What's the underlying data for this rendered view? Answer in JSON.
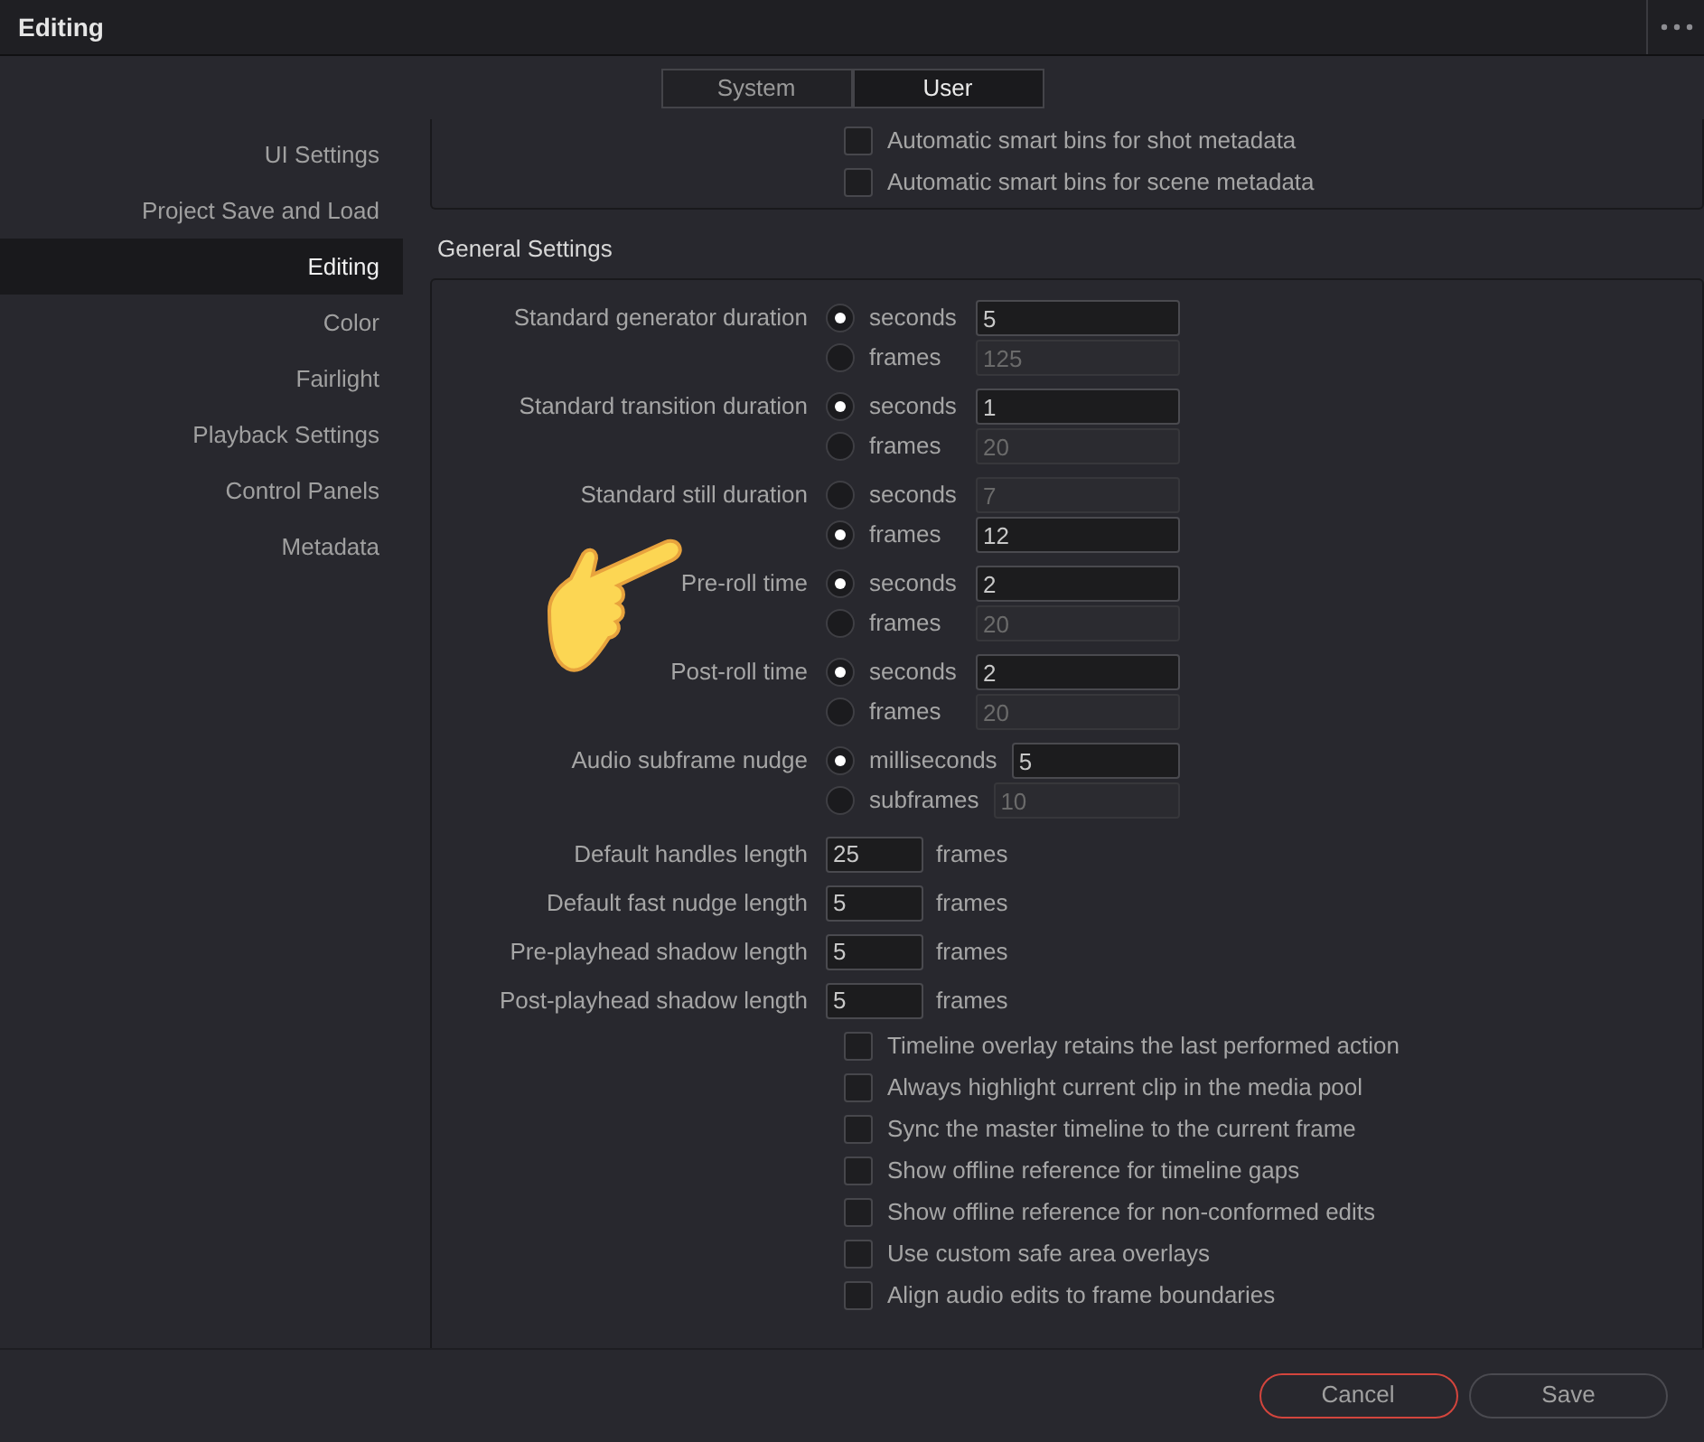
{
  "window": {
    "title": "Editing"
  },
  "scope_tabs": [
    {
      "label": "System",
      "selected": false
    },
    {
      "label": "User",
      "selected": true
    }
  ],
  "sidebar": {
    "items": [
      {
        "label": "UI Settings",
        "selected": false
      },
      {
        "label": "Project Save and Load",
        "selected": false
      },
      {
        "label": "Editing",
        "selected": true
      },
      {
        "label": "Color",
        "selected": false
      },
      {
        "label": "Fairlight",
        "selected": false
      },
      {
        "label": "Playback Settings",
        "selected": false
      },
      {
        "label": "Control Panels",
        "selected": false
      },
      {
        "label": "Metadata",
        "selected": false
      }
    ]
  },
  "top_section": {
    "checkboxes": [
      {
        "label": "Automatic smart bins for shot metadata",
        "checked": false
      },
      {
        "label": "Automatic smart bins for scene metadata",
        "checked": false
      }
    ]
  },
  "general_settings": {
    "title": "General Settings",
    "settings": [
      {
        "kind": "radio",
        "label": "Standard generator duration",
        "options": [
          {
            "unit": "seconds",
            "selected": true,
            "value": "5"
          },
          {
            "unit": "frames",
            "selected": false,
            "value": "125"
          }
        ]
      },
      {
        "kind": "radio",
        "label": "Standard transition duration",
        "options": [
          {
            "unit": "seconds",
            "selected": true,
            "value": "1"
          },
          {
            "unit": "frames",
            "selected": false,
            "value": "20"
          }
        ]
      },
      {
        "kind": "radio",
        "label": "Standard still duration",
        "options": [
          {
            "unit": "seconds",
            "selected": false,
            "value": "7"
          },
          {
            "unit": "frames",
            "selected": true,
            "value": "12"
          }
        ]
      },
      {
        "kind": "radio",
        "label": "Pre-roll time",
        "options": [
          {
            "unit": "seconds",
            "selected": true,
            "value": "2"
          },
          {
            "unit": "frames",
            "selected": false,
            "value": "20"
          }
        ]
      },
      {
        "kind": "radio",
        "label": "Post-roll time",
        "options": [
          {
            "unit": "seconds",
            "selected": true,
            "value": "2"
          },
          {
            "unit": "frames",
            "selected": false,
            "value": "20"
          }
        ]
      },
      {
        "kind": "radio",
        "label": "Audio subframe nudge",
        "options": [
          {
            "unit": "milliseconds",
            "selected": true,
            "value": "5"
          },
          {
            "unit": "subframes",
            "selected": false,
            "value": "10"
          }
        ]
      },
      {
        "kind": "length",
        "label": "Default handles length",
        "value": "25",
        "unit": "frames"
      },
      {
        "kind": "length",
        "label": "Default fast nudge length",
        "value": "5",
        "unit": "frames"
      },
      {
        "kind": "length",
        "label": "Pre-playhead shadow length",
        "value": "5",
        "unit": "frames"
      },
      {
        "kind": "length",
        "label": "Post-playhead shadow length",
        "value": "5",
        "unit": "frames"
      },
      {
        "kind": "checkbox",
        "label": "Timeline overlay retains the last performed action",
        "checked": false
      },
      {
        "kind": "checkbox",
        "label": "Always highlight current clip in the media pool",
        "checked": false
      },
      {
        "kind": "checkbox",
        "label": "Sync the master timeline to the current frame",
        "checked": false
      },
      {
        "kind": "checkbox",
        "label": "Show offline reference for timeline gaps",
        "checked": false
      },
      {
        "kind": "checkbox",
        "label": "Show offline reference for non-conformed edits",
        "checked": false
      },
      {
        "kind": "checkbox",
        "label": "Use custom safe area overlays",
        "checked": false
      },
      {
        "kind": "checkbox",
        "label": "Align audio edits to frame boundaries",
        "checked": false
      }
    ]
  },
  "buttons": [
    {
      "kind": "cancel",
      "label": "Cancel"
    },
    {
      "kind": "save",
      "label": "Save"
    }
  ]
}
